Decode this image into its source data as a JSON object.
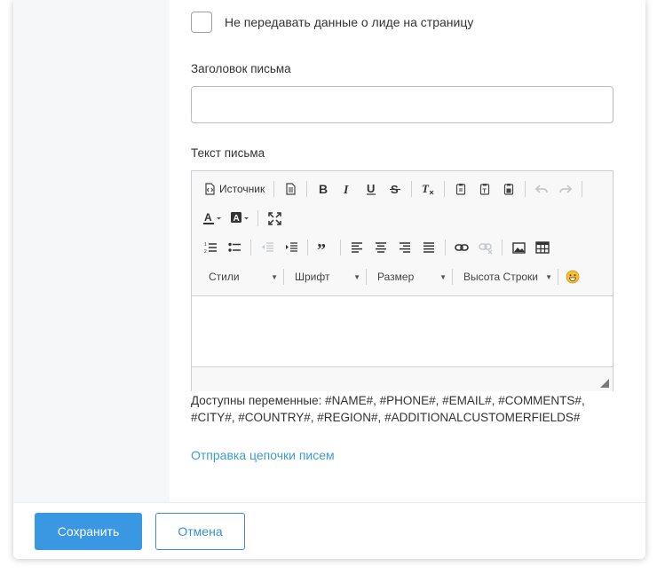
{
  "form": {
    "no_pass_lead_label": "Не передавать данные о лиде на страницу",
    "subject_label": "Заголовок письма",
    "subject_value": "",
    "body_label": "Текст письма"
  },
  "editor": {
    "source_label": "Источник",
    "combos": {
      "styles": "Стили",
      "font": "Шрифт",
      "size": "Размер",
      "line_height": "Высота Строки"
    },
    "icons": [
      "source-icon",
      "new-page-icon",
      "bold-icon",
      "italic-icon",
      "underline-icon",
      "strikethrough-icon",
      "remove-format-icon",
      "paste-icon",
      "paste-text-icon",
      "paste-word-icon",
      "undo-icon",
      "redo-icon",
      "text-color-icon",
      "bg-color-icon",
      "maximize-icon",
      "numbered-list-icon",
      "bulleted-list-icon",
      "outdent-icon",
      "indent-icon",
      "blockquote-icon",
      "align-left-icon",
      "align-center-icon",
      "align-right-icon",
      "justify-icon",
      "link-icon",
      "unlink-icon",
      "image-icon",
      "table-icon",
      "emoji-icon"
    ]
  },
  "hint": {
    "variables_text": "Доступны переменные: #NAME#, #PHONE#, #EMAIL#, #COMMENTS#, #CITY#, #COUNTRY#, #REGION#, #ADDITIONALCUSTOMERFIELDS#"
  },
  "chain_link_label": "Отправка цепочки писем",
  "buttons": {
    "save": "Сохранить",
    "cancel": "Отмена"
  },
  "colors": {
    "accent": "#3a97e1",
    "link": "#3e9bd0",
    "side_panel": "#f6f7f9"
  }
}
